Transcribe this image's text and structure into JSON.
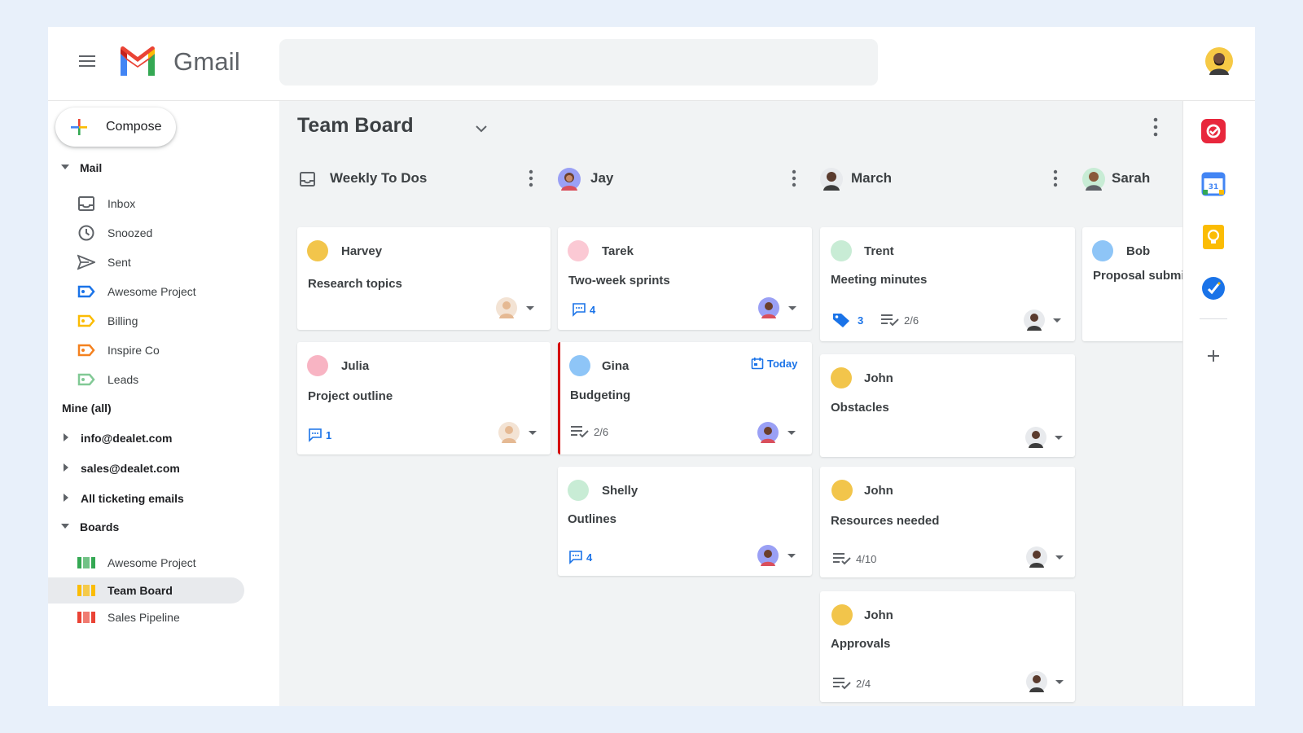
{
  "app": {
    "logo_text": "Gmail",
    "search_placeholder": ""
  },
  "sidebar": {
    "compose_label": "Compose",
    "mail_section": "Mail",
    "mail_items": [
      {
        "label": "Inbox",
        "icon": "inbox-icon"
      },
      {
        "label": "Snoozed",
        "icon": "clock-icon"
      },
      {
        "label": "Sent",
        "icon": "send-icon"
      },
      {
        "label": "Awesome Project",
        "icon": "label-icon",
        "color": "#1a73e8"
      },
      {
        "label": "Billing",
        "icon": "label-icon",
        "color": "#fbbc04"
      },
      {
        "label": "Inspire Co",
        "icon": "label-icon",
        "color": "#f4811f"
      },
      {
        "label": "Leads",
        "icon": "label-icon",
        "color": "#81c995"
      }
    ],
    "mine_section": "Mine (all)",
    "accounts": [
      "info@dealet.com",
      "sales@dealet.com",
      "All ticketing emails"
    ],
    "boards_section": "Boards",
    "board_items": [
      {
        "label": "Awesome Project",
        "color": "#34a853"
      },
      {
        "label": "Team Board",
        "color": "#fbbc04",
        "active": true
      },
      {
        "label": "Sales Pipeline",
        "color": "#ea4335"
      }
    ]
  },
  "board": {
    "title": "Team Board",
    "columns": [
      {
        "name": "Weekly To Dos",
        "cards": [
          {
            "who": "Harvey",
            "dot": "#f2c54b",
            "subject": "Research topics"
          },
          {
            "who": "Julia",
            "dot": "#f8b4c3",
            "subject": "Project outline",
            "comments": "1"
          }
        ]
      },
      {
        "name": "Jay",
        "cards": [
          {
            "who": "Tarek",
            "dot": "#fbc9d4",
            "subject": "Two-week sprints",
            "comments": "4"
          },
          {
            "who": "Gina",
            "dot": "#8ec5f7",
            "subject": "Budgeting",
            "tasks": "2/6",
            "due": "Today"
          },
          {
            "who": "Shelly",
            "dot": "#c8ecd5",
            "subject": "Outlines",
            "comments": "4"
          }
        ]
      },
      {
        "name": "March",
        "cards": [
          {
            "who": "Trent",
            "dot": "#c8ecd5",
            "subject": "Meeting minutes",
            "tags": "3",
            "tasks": "2/6"
          },
          {
            "who": "John",
            "dot": "#f2c54b",
            "subject": "Obstacles"
          },
          {
            "who": "John",
            "dot": "#f2c54b",
            "subject": "Resources needed",
            "tasks": "4/10"
          },
          {
            "who": "John",
            "dot": "#f2c54b",
            "subject": "Approvals",
            "tasks": "2/4"
          }
        ]
      },
      {
        "name": "Sarah",
        "cards": [
          {
            "who": "Bob",
            "dot": "#8ec5f7",
            "subject": "Proposal submi"
          }
        ]
      }
    ]
  },
  "colors": {
    "accent": "#1a73e8",
    "due_bar": "#d50000"
  }
}
